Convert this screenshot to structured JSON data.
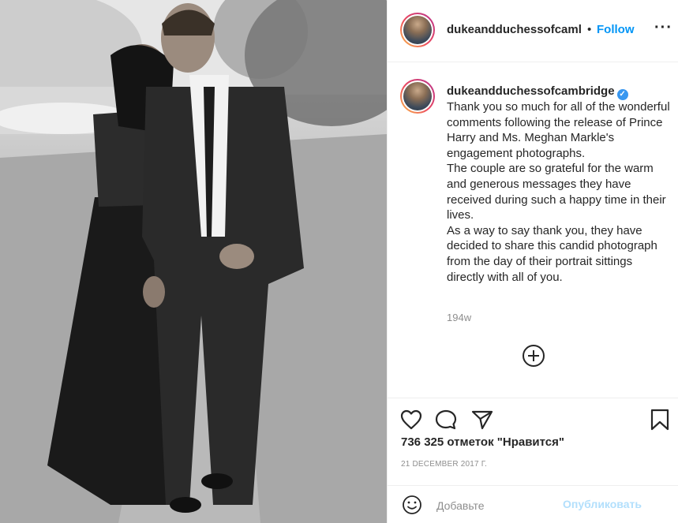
{
  "post": {
    "username": "dukeandduchessofcambridge",
    "header_username": "dukeandduchessofcaml",
    "separator": "•",
    "follow_label": "Follow",
    "more_label": "···",
    "caption_paragraphs": [
      "Thank you so much for all of the wonderful comments following the release of Prince Harry and Ms. Meghan Markle's engagement photographs.",
      "The couple are so grateful for the warm and generous messages they have received during such a happy time in their lives.",
      "As a way to say thank you, they have decided to share this candid photograph from the day of their portrait sittings directly with all of you."
    ],
    "relative_time": "194w",
    "likes_text": "736 325 отметок \"Нравится\"",
    "date_text": "21 DECEMBER 2017 Г.",
    "comment_placeholder": "Добавьте",
    "publish_label": "Опубликовать"
  },
  "icons": {
    "like": "heart-icon",
    "comment": "comment-icon",
    "share": "share-icon",
    "save": "bookmark-icon",
    "emoji": "smiley-icon",
    "load_more": "plus-circle-icon",
    "verified": "verified-badge-icon"
  },
  "colors": {
    "link": "#0095f6",
    "verified": "#3897f0",
    "muted": "#8e8e8e",
    "publish_disabled": "#b2dffc"
  }
}
